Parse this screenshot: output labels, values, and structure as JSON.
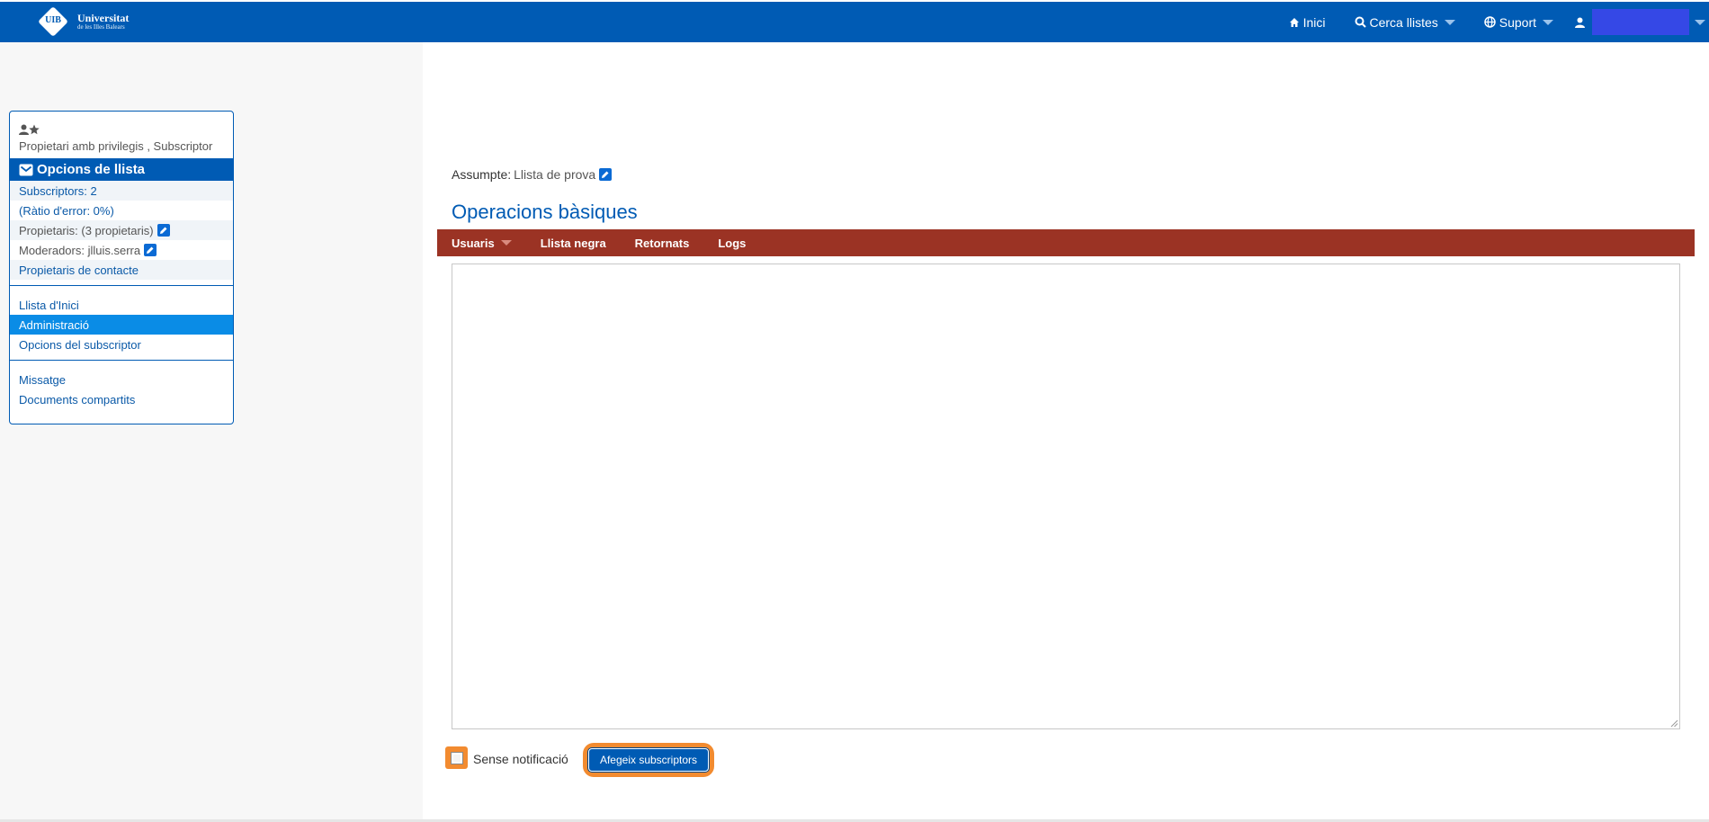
{
  "header": {
    "logo_line1": "Universitat",
    "logo_line2": "de les Illes Balears",
    "logo_mark": "UIB",
    "nav": {
      "home_label": "Inici",
      "search_label": "Cerca llistes",
      "support_label": "Suport"
    }
  },
  "sidebar": {
    "roles": "Propietari amb privilegis , Subscriptor",
    "options_title": "Opcions de llista",
    "info": {
      "subscribers": "Subscriptors: 2",
      "error_ratio": "(Ràtio d'error: 0%)",
      "owners": "Propietaris: (3 propietaris)",
      "moderators": "Moderadors: jlluis.serra",
      "contact_owners": "Propietaris de contacte"
    },
    "nav": {
      "home_list": "Llista d'Inici",
      "admin": "Administració",
      "subscriber_options": "Opcions del subscriptor"
    },
    "extra": {
      "message": "Missatge",
      "shared_docs": "Documents compartits"
    }
  },
  "main": {
    "subject_label": "Assumpte:",
    "subject_value": "Llista de prova",
    "title": "Operacions bàsiques",
    "tabs": {
      "users": "Usuaris",
      "blacklist": "Llista negra",
      "bounces": "Retornats",
      "logs": "Logs"
    },
    "textarea_value": "",
    "no_notify_label": "Sense notificació",
    "add_button": "Afegeix subscriptors"
  },
  "colors": {
    "brand_blue": "#005bb4",
    "tab_red": "#9b3324",
    "highlight_orange": "#f28b30",
    "active_item": "#0a8ce6"
  }
}
